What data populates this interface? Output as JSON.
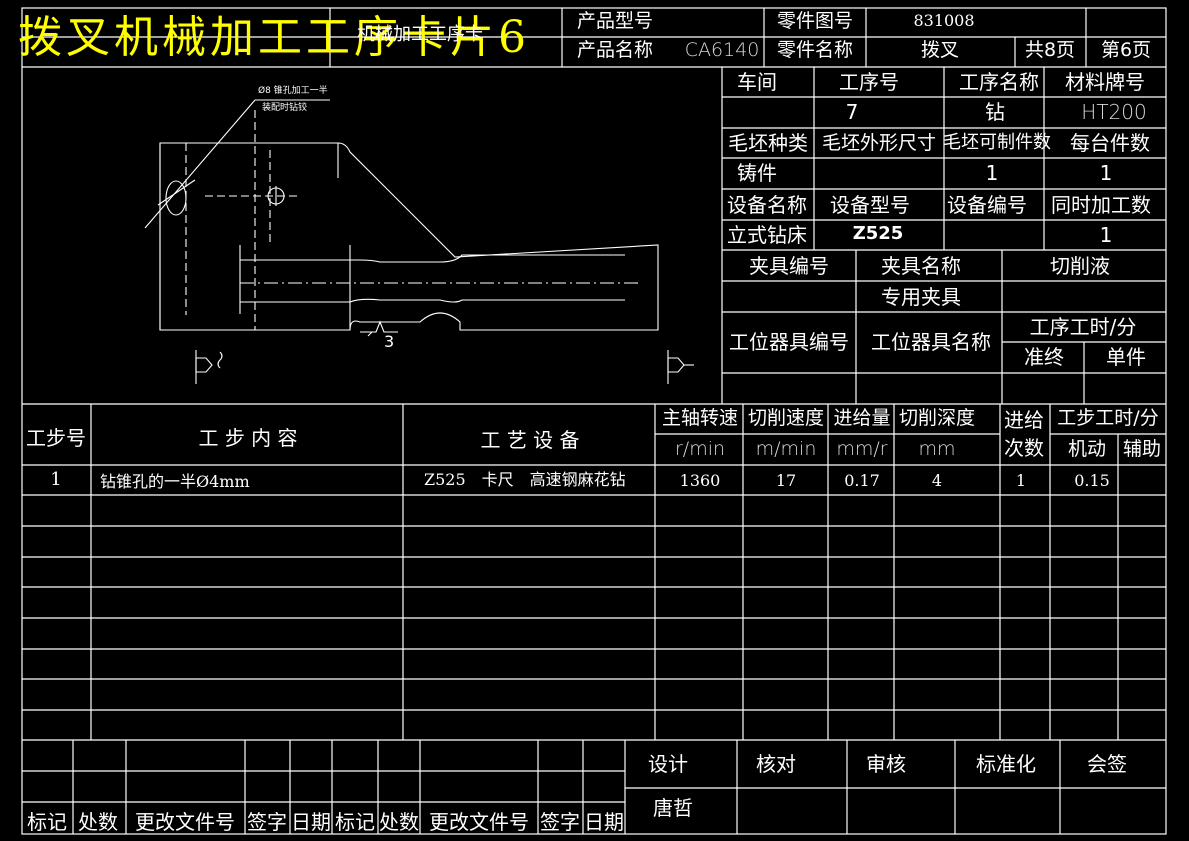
{
  "banner_title": "拨叉机械加工工序卡片6",
  "header": {
    "card_title": "机械加工工序卡",
    "product_model_label": "产品型号",
    "product_name_label": "产品名称",
    "product_name": "CA6140",
    "part_drawing_no_label": "零件图号",
    "part_drawing_no": "831008",
    "part_name_label": "零件名称",
    "part_name": "拨叉",
    "total_pages": "共8页",
    "page_no": "第6页"
  },
  "info": {
    "workshop_label": "车间",
    "op_no_label": "工序号",
    "op_name_label": "工序名称",
    "material_label": "材料牌号",
    "op_no": "7",
    "op_name": "钻",
    "material": "HT200",
    "blank_type_label": "毛坯种类",
    "blank_size_label": "毛坯外形尺寸",
    "blank_count_label": "毛坯可制件数",
    "per_unit_label": "每台件数",
    "blank_type": "铸件",
    "blank_count": "1",
    "per_unit": "1",
    "equip_name_label": "设备名称",
    "equip_model_label": "设备型号",
    "equip_no_label": "设备编号",
    "simul_label": "同时加工数",
    "equip_name": "立式钻床",
    "equip_model": "Z525",
    "simul": "1",
    "fixture_no_label": "夹具编号",
    "fixture_name_label": "夹具名称",
    "coolant_label": "切削液",
    "fixture_name": "专用夹具",
    "station_no_label": "工位器具编号",
    "station_name_label": "工位器具名称",
    "op_time_label": "工序工时/分",
    "prep_label": "准终",
    "unit_label": "单件"
  },
  "drawing": {
    "note_line1": "Ø8 锥孔加工一半",
    "note_line2": "装配时钻铰",
    "dim_label": "3"
  },
  "steps_header": {
    "step_no": "工步号",
    "step_content": "工 步 内 容",
    "equipment": "工 艺 设 备",
    "spindle": "主轴转速",
    "spindle_unit": "r/min",
    "cut_speed": "切削速度",
    "cut_speed_unit": "m/min",
    "feed": "进给量",
    "feed_unit": "mm/r",
    "depth": "切削深度",
    "depth_unit": "mm",
    "passes_1": "进给",
    "passes_2": "次数",
    "step_time": "工步工时/分",
    "machine": "机动",
    "aux": "辅助"
  },
  "steps": [
    {
      "no": "1",
      "content": "钻锥孔的一半Ø4mm",
      "equipment": "Z525　卡尺　高速钢麻花钻",
      "spindle": "1360",
      "speed": "17",
      "feed": "0.17",
      "depth": "4",
      "passes": "1",
      "machine": "0.15"
    }
  ],
  "footer": {
    "design": "设计",
    "check": "核对",
    "review": "审核",
    "standard": "标准化",
    "sign": "会签",
    "designer": "唐哲",
    "mark": "标记",
    "count": "处数",
    "change_doc": "更改文件号",
    "signature": "签字",
    "date": "日期"
  }
}
